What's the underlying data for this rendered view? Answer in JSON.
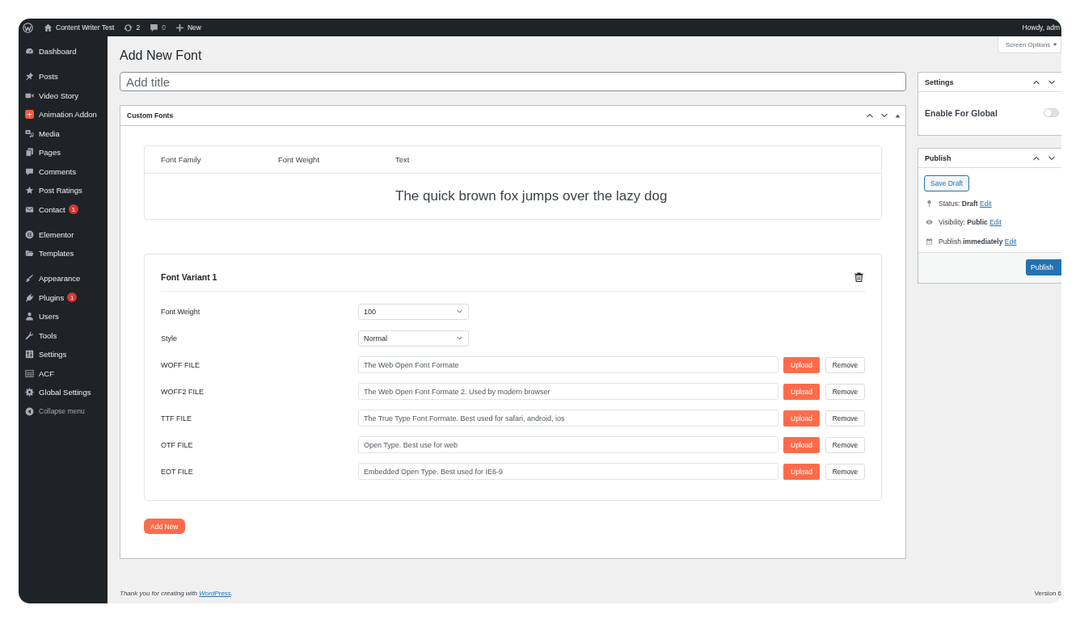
{
  "admin_bar": {
    "site_name": "Content Writer Test",
    "updates": "2",
    "comments": "0",
    "new_label": "New",
    "greeting": "Howdy, adm"
  },
  "sidebar": {
    "groups": [
      {
        "items": [
          {
            "label": "Dashboard",
            "selected": false
          }
        ]
      },
      {
        "items": [
          {
            "label": "Posts",
            "selected": false
          },
          {
            "label": "Video Story",
            "selected": false
          },
          {
            "label": "Animation Addon",
            "selected": false
          },
          {
            "label": "Media",
            "selected": false
          },
          {
            "label": "Pages",
            "selected": false
          },
          {
            "label": "Comments",
            "selected": false
          },
          {
            "label": "Post Ratings",
            "selected": false
          },
          {
            "label": "Contact",
            "selected": false,
            "badge": "1"
          }
        ]
      },
      {
        "items": [
          {
            "label": "Elementor",
            "selected": false
          },
          {
            "label": "Templates",
            "selected": false
          }
        ]
      },
      {
        "items": [
          {
            "label": "Appearance",
            "selected": false
          },
          {
            "label": "Plugins",
            "selected": false,
            "badge": "1"
          },
          {
            "label": "Users",
            "selected": false
          },
          {
            "label": "Tools",
            "selected": false
          },
          {
            "label": "Settings",
            "selected": false
          },
          {
            "label": "ACF",
            "selected": false
          },
          {
            "label": "Global Settings",
            "selected": false
          }
        ]
      }
    ],
    "collapse_label": "Collapse menu"
  },
  "page_title": "Add New Font",
  "screen_options": "Screen Options",
  "title_field": {
    "placeholder": "Add title"
  },
  "custom_fonts": {
    "title": "Custom Fonts",
    "preview": {
      "columns": [
        "Font Family",
        "Font Weight",
        "Text"
      ],
      "sample": "The quick brown fox jumps over the lazy dog"
    },
    "variants": [
      {
        "title": "Font Variant 1",
        "fields": [
          {
            "kind": "select",
            "label": "Font Weight",
            "value": "100"
          },
          {
            "kind": "select",
            "label": "Style",
            "value": "Normal"
          },
          {
            "kind": "file",
            "label": "WOFF FILE",
            "placeholder": "The Web Open Font Formate",
            "upload_label": "Upload",
            "remove_label": "Remove"
          },
          {
            "kind": "file",
            "label": "WOFF2 FILE",
            "placeholder": "The Web Open Font Formate 2. Used by modern browser",
            "upload_label": "Upload",
            "remove_label": "Remove"
          },
          {
            "kind": "file",
            "label": "TTF FILE",
            "placeholder": "The True Type Font Formate. Best used for safari, android, ios",
            "upload_label": "Upload",
            "remove_label": "Remove"
          },
          {
            "kind": "file",
            "label": "OTF FILE",
            "placeholder": "Open Type. Best use for web",
            "upload_label": "Upload",
            "remove_label": "Remove"
          },
          {
            "kind": "file",
            "label": "EOT FILE",
            "placeholder": "Embedded Open Type. Best used for IE6-9",
            "upload_label": "Upload",
            "remove_label": "Remove"
          }
        ]
      }
    ],
    "add_button": "Add New"
  },
  "settings_box": {
    "title": "Settings",
    "toggle": {
      "label": "Enable For Global",
      "on": false
    }
  },
  "publish_box": {
    "title": "Publish",
    "save_draft": "Save Draft",
    "meta": [
      {
        "text": "Status: **Draft**",
        "link": "Edit"
      },
      {
        "text": "Visibility: **Public**",
        "link": "Edit"
      },
      {
        "text": "Publish **immediately**",
        "link": "Edit"
      }
    ],
    "publish_button": "Publish"
  },
  "footer": {
    "thanks": "Thank you for creating with",
    "link": "WordPress",
    "end": ".",
    "version": "Version 6"
  }
}
